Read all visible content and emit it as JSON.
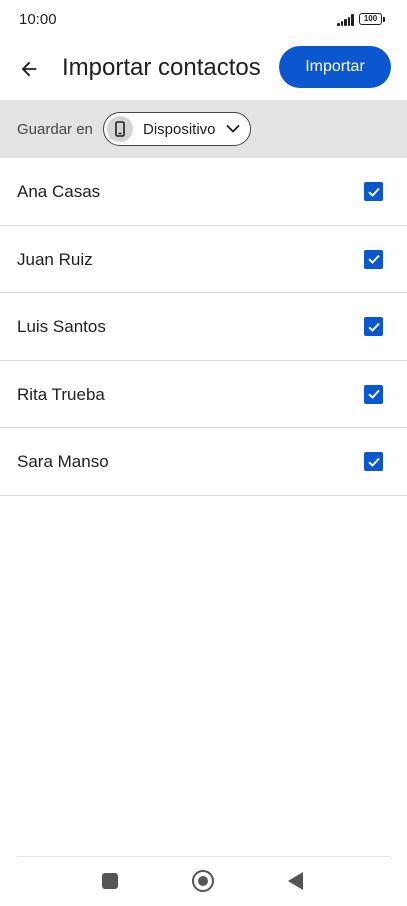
{
  "status_bar": {
    "time": "10:00",
    "battery": "100"
  },
  "header": {
    "back_icon": "arrow-left-icon",
    "title": "Importar contactos",
    "import_label": "Importar"
  },
  "save_to": {
    "label": "Guardar en",
    "account_icon": "phone-icon",
    "account": "Dispositivo",
    "caret_icon": "chevron-down-icon"
  },
  "contacts": [
    {
      "name": "Ana Casas",
      "checked": true
    },
    {
      "name": "Juan Ruiz",
      "checked": true
    },
    {
      "name": "Luis Santos",
      "checked": true
    },
    {
      "name": "Rita Trueba",
      "checked": true
    },
    {
      "name": "Sara Manso",
      "checked": true
    }
  ],
  "colors": {
    "accent": "#0b57d0",
    "save_bar_bg": "#e3e3e3",
    "text": "#1f1f1f"
  }
}
